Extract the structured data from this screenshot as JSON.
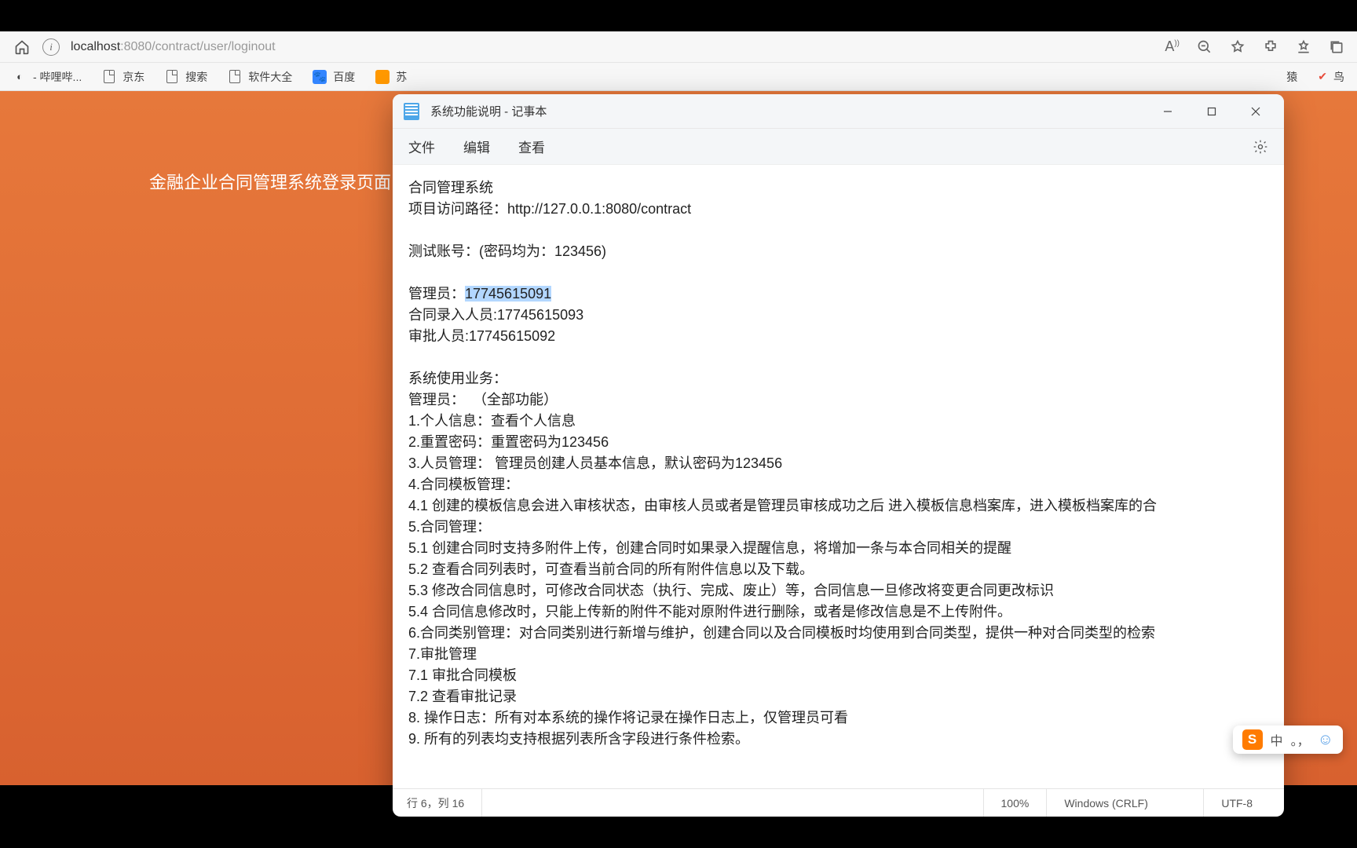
{
  "browser": {
    "url_host": "localhost",
    "url_port_path": ":8080/contract/user/loginout"
  },
  "bookmarks": {
    "items": [
      {
        "label": "- 哔哩哔..."
      },
      {
        "label": "京东"
      },
      {
        "label": "搜索"
      },
      {
        "label": "软件大全"
      },
      {
        "label": "百度"
      },
      {
        "label": "苏"
      }
    ],
    "right": [
      {
        "label": "猿"
      },
      {
        "label": "鸟"
      }
    ]
  },
  "page": {
    "title": "金融企业合同管理系统登录页面"
  },
  "notepad": {
    "title": "系统功能说明 - 记事本",
    "menu": {
      "file": "文件",
      "edit": "编辑",
      "view": "查看"
    },
    "content": {
      "l1": "合同管理系统",
      "l2a": "项目访问路径：",
      "l2b": "http://127.0.0.1:8080/contract",
      "l3": "测试账号：(密码均为：123456)",
      "l4a": "管理员：",
      "l4b": "17745615091",
      "l5": "合同录入人员:17745615093",
      "l6": "审批人员:17745615092",
      "l7": "系统使用业务：",
      "l8": "管理员：  （全部功能）",
      "l9": "1.个人信息：查看个人信息",
      "l10": "2.重置密码：重置密码为123456",
      "l11": "3.人员管理： 管理员创建人员基本信息，默认密码为123456",
      "l12": "4.合同模板管理：",
      "l13": "4.1 创建的模板信息会进入审核状态，由审核人员或者是管理员审核成功之后 进入模板信息档案库，进入模板档案库的合",
      "l14": "5.合同管理：",
      "l15": "5.1 创建合同时支持多附件上传，创建合同时如果录入提醒信息，将增加一条与本合同相关的提醒",
      "l16": "5.2 查看合同列表时，可查看当前合同的所有附件信息以及下载。",
      "l17": "5.3 修改合同信息时，可修改合同状态（执行、完成、废止）等，合同信息一旦修改将变更合同更改标识",
      "l18": "5.4 合同信息修改时，只能上传新的附件不能对原附件进行删除，或者是修改信息是不上传附件。",
      "l19": "6.合同类别管理：对合同类别进行新增与维护，创建合同以及合同模板时均使用到合同类型，提供一种对合同类型的检索",
      "l20": "7.审批管理",
      "l21": "7.1 审批合同模板",
      "l22": "7.2 查看审批记录",
      "l23": "8. 操作日志：所有对本系统的操作将记录在操作日志上，仅管理员可看",
      "l24": "9. 所有的列表均支持根据列表所含字段进行条件检索。"
    },
    "status": {
      "pos": "行 6，列 16",
      "zoom": "100%",
      "eol": "Windows (CRLF)",
      "enc": "UTF-8"
    }
  },
  "ime": {
    "lang": "中",
    "dot": "。，"
  }
}
